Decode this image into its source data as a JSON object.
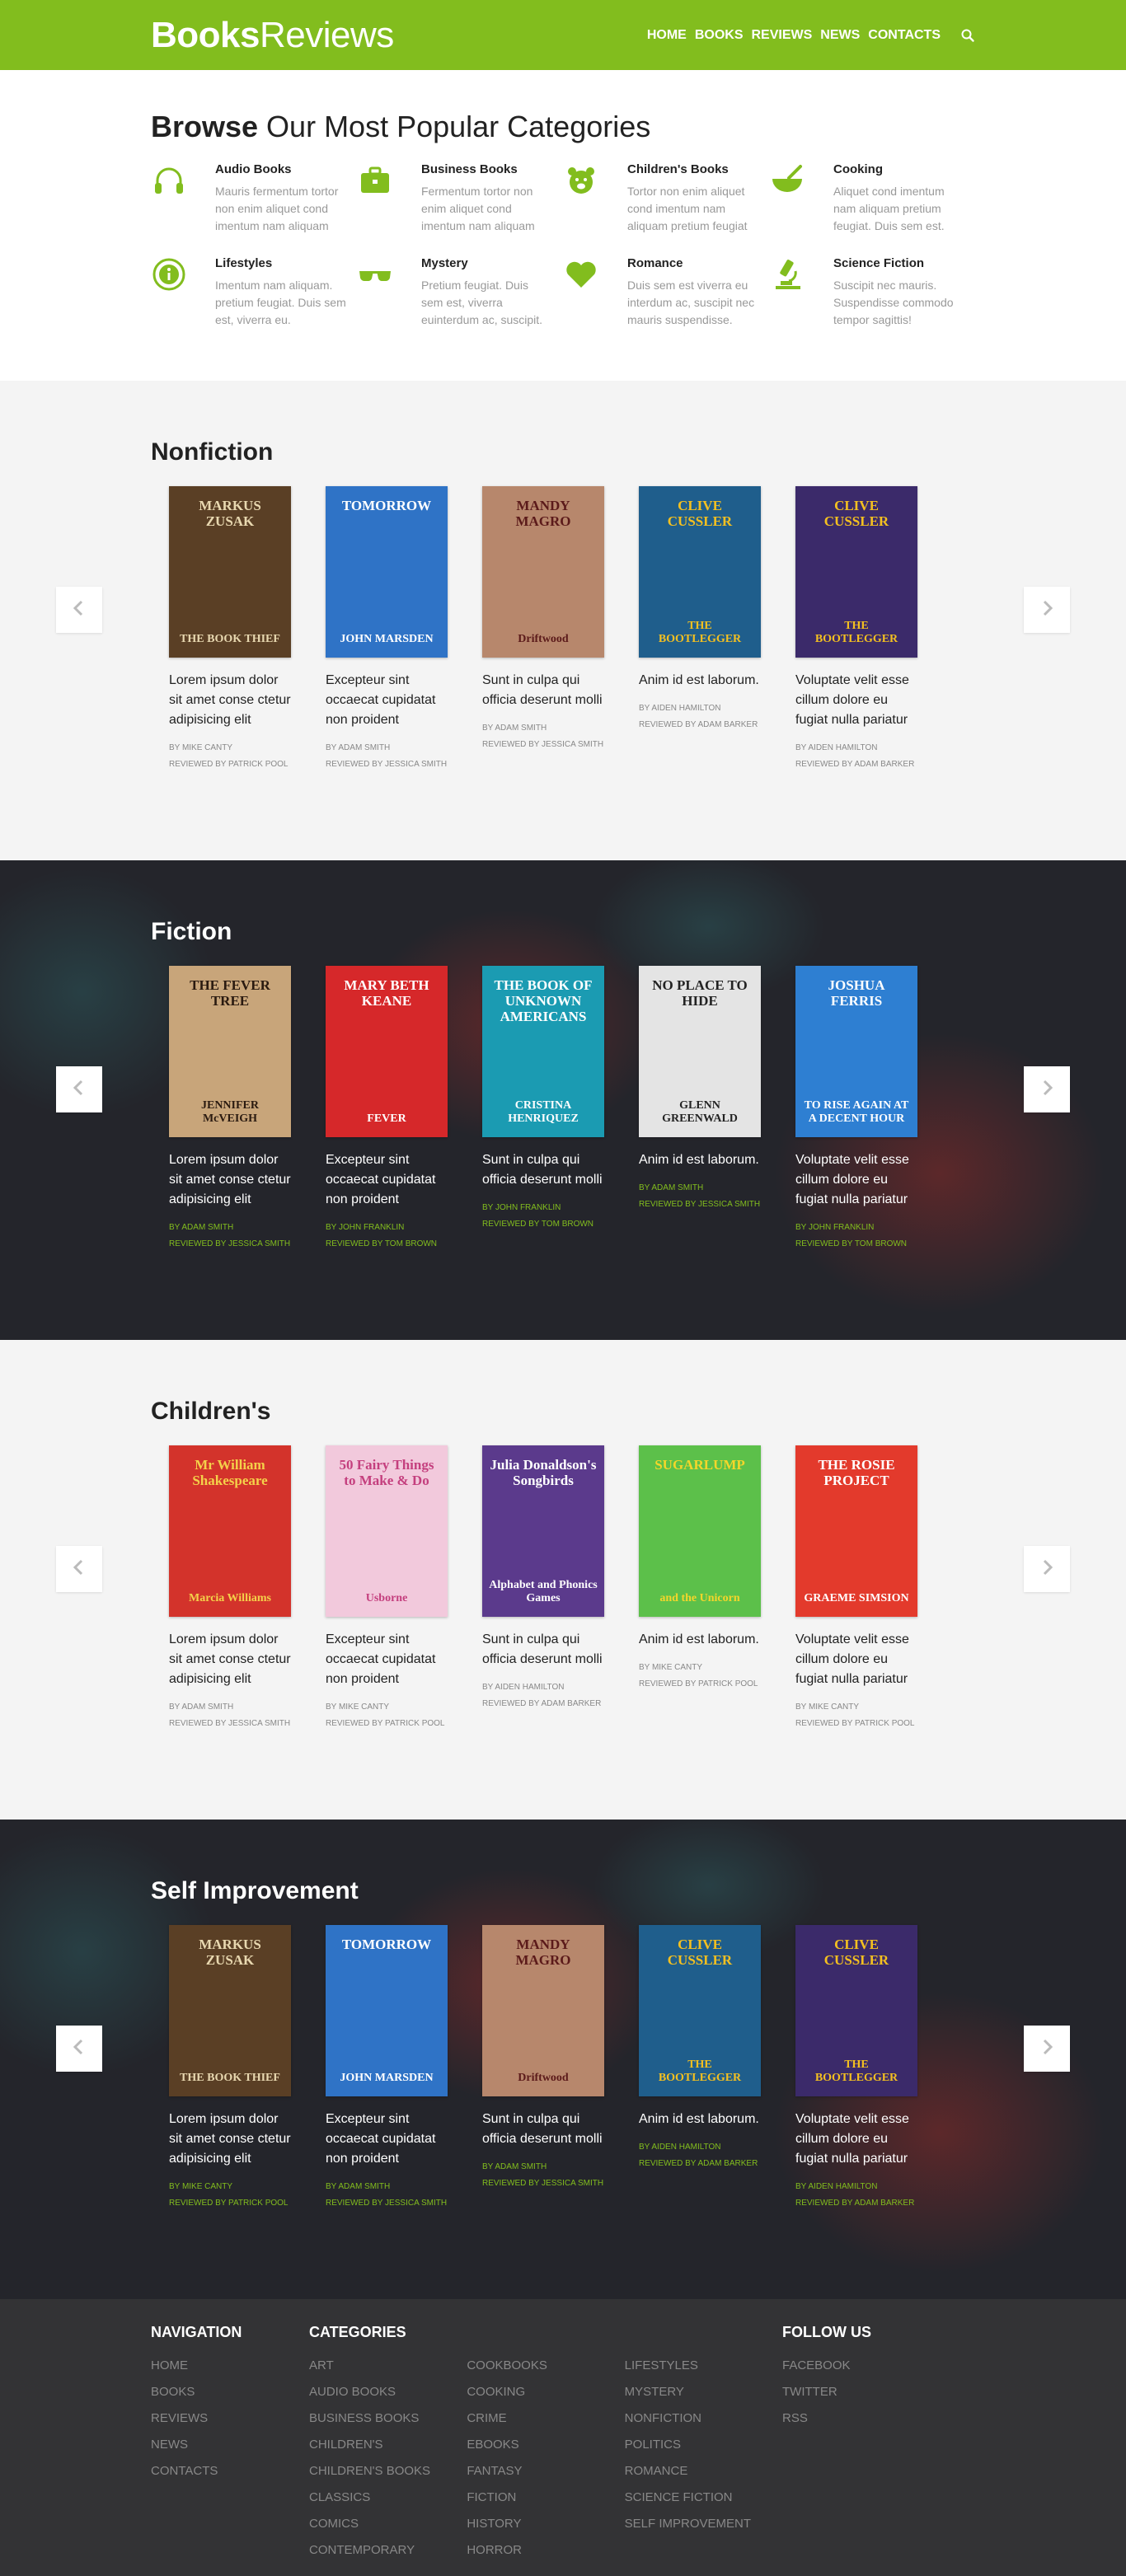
{
  "brand": {
    "bold": "Books",
    "light": "Reviews"
  },
  "nav": [
    "HOME",
    "BOOKS",
    "REVIEWS",
    "NEWS",
    "CONTACTS"
  ],
  "categories_heading": {
    "bold": "Browse",
    "rest": " Our Most Popular Categories"
  },
  "categories": [
    {
      "icon": "headphones-icon",
      "title": "Audio Books",
      "desc": "Mauris fermentum tortor non enim aliquet cond imentum nam aliquam"
    },
    {
      "icon": "briefcase-icon",
      "title": "Business Books",
      "desc": "Fermentum tortor non enim aliquet cond imentum nam aliquam"
    },
    {
      "icon": "teddy-bear-icon",
      "title": "Children's Books",
      "desc": "Tortor non enim aliquet cond imentum nam aliquam pretium feugiat"
    },
    {
      "icon": "mortar-pestle-icon",
      "title": "Cooking",
      "desc": "Aliquet cond imentum nam aliquam pretium feugiat. Duis sem est."
    },
    {
      "icon": "info-circle-icon",
      "title": "Lifestyles",
      "desc": "Imentum nam aliquam. pretium feugiat. Duis sem est, viverra eu."
    },
    {
      "icon": "sunglasses-icon",
      "title": "Mystery",
      "desc": "Pretium feugiat. Duis sem est, viverra euinterdum ac, suscipit."
    },
    {
      "icon": "heart-icon",
      "title": "Romance",
      "desc": "Duis sem est viverra eu interdum ac, suscipit nec mauris suspendisse."
    },
    {
      "icon": "microscope-icon",
      "title": "Science Fiction",
      "desc": "Suscipit nec mauris. Suspendisse commodo tempor sagittis!"
    }
  ],
  "sections": [
    {
      "title": "Nonfiction",
      "theme": "light",
      "books": [
        {
          "title": "Lorem ipsum dolor sit amet conse ctetur adipisicing elit",
          "by": "BY MIKE CANTY",
          "reviewed": "REVIEWED BY PATRICK POOL",
          "cover": {
            "top": "MARKUS ZUSAK",
            "bottom": "THE BOOK THIEF",
            "bg": "#5a3f25",
            "fg": "#e8d8b0"
          }
        },
        {
          "title": "Excepteur sint occaecat cupidatat non proident",
          "by": "BY ADAM SMITH",
          "reviewed": "REVIEWED BY JESSICA SMITH",
          "cover": {
            "top": "TOMORROW",
            "bottom": "JOHN MARSDEN",
            "bg": "#2f73c6",
            "fg": "#ffffff"
          }
        },
        {
          "title": "Sunt in culpa qui officia deserunt molli",
          "by": "BY ADAM SMITH",
          "reviewed": "REVIEWED BY JESSICA SMITH",
          "cover": {
            "top": "MANDY MAGRO",
            "bottom": "Driftwood",
            "bg": "#b7876c",
            "fg": "#5b1a1a"
          }
        },
        {
          "title": "Anim id est laborum.",
          "by": "BY AIDEN HAMILTON",
          "reviewed": "REVIEWED BY ADAM BARKER",
          "cover": {
            "top": "CLIVE CUSSLER",
            "bottom": "THE BOOTLEGGER",
            "bg": "#1f5e8c",
            "fg": "#f4c020"
          }
        },
        {
          "title": "Voluptate velit esse cillum dolore eu fugiat nulla pariatur",
          "by": "BY AIDEN HAMILTON",
          "reviewed": "REVIEWED BY ADAM BARKER",
          "cover": {
            "top": "CLIVE CUSSLER",
            "bottom": "THE BOOTLEGGER",
            "bg": "#3b2a6a",
            "fg": "#f4c020"
          }
        }
      ]
    },
    {
      "title": "Fiction",
      "theme": "dark",
      "books": [
        {
          "title": "Lorem ipsum dolor sit amet conse ctetur adipisicing elit",
          "by": "BY ADAM SMITH",
          "reviewed": "REVIEWED BY JESSICA SMITH",
          "cover": {
            "top": "THE FEVER TREE",
            "bottom": "JENNIFER McVEIGH",
            "bg": "#c8a57a",
            "fg": "#2a1a10"
          }
        },
        {
          "title": "Excepteur sint occaecat cupidatat non proident",
          "by": "BY JOHN FRANKLIN",
          "reviewed": "REVIEWED BY TOM BROWN",
          "cover": {
            "top": "MARY BETH KEANE",
            "bottom": "FEVER",
            "bg": "#d6282a",
            "fg": "#ffffff"
          }
        },
        {
          "title": "Sunt in culpa qui officia deserunt molli",
          "by": "BY JOHN FRANKLIN",
          "reviewed": "REVIEWED BY TOM BROWN",
          "cover": {
            "top": "THE BOOK OF UNKNOWN AMERICANS",
            "bottom": "CRISTINA HENRIQUEZ",
            "bg": "#1b9bb2",
            "fg": "#ffffff"
          }
        },
        {
          "title": "Anim id est laborum.",
          "by": "BY ADAM SMITH",
          "reviewed": "REVIEWED BY JESSICA SMITH",
          "cover": {
            "top": "NO PLACE TO HIDE",
            "bottom": "GLENN GREENWALD",
            "bg": "#e4e4e4",
            "fg": "#222222"
          }
        },
        {
          "title": "Voluptate velit esse cillum dolore eu fugiat nulla pariatur",
          "by": "BY JOHN FRANKLIN",
          "reviewed": "REVIEWED BY TOM BROWN",
          "cover": {
            "top": "JOSHUA FERRIS",
            "bottom": "TO RISE AGAIN AT A DECENT HOUR",
            "bg": "#2e7fd2",
            "fg": "#ffffff"
          }
        }
      ]
    },
    {
      "title": "Children's",
      "theme": "light",
      "books": [
        {
          "title": "Lorem ipsum dolor sit amet conse ctetur adipisicing elit",
          "by": "BY ADAM SMITH",
          "reviewed": "REVIEWED BY JESSICA SMITH",
          "cover": {
            "top": "Mr William Shakespeare",
            "bottom": "Marcia Williams",
            "bg": "#d3332b",
            "fg": "#f4d14a"
          }
        },
        {
          "title": "Excepteur sint occaecat cupidatat non proident",
          "by": "BY MIKE CANTY",
          "reviewed": "REVIEWED BY PATRICK POOL",
          "cover": {
            "top": "50 Fairy Things to Make & Do",
            "bottom": "Usborne",
            "bg": "#f2c9dc",
            "fg": "#c43f7e"
          }
        },
        {
          "title": "Sunt in culpa qui officia deserunt molli",
          "by": "BY AIDEN HAMILTON",
          "reviewed": "REVIEWED BY ADAM BARKER",
          "cover": {
            "top": "Julia Donaldson's Songbirds",
            "bottom": "Alphabet and Phonics Games",
            "bg": "#5b3a8c",
            "fg": "#ffffff"
          }
        },
        {
          "title": "Anim id est laborum.",
          "by": "BY MIKE CANTY",
          "reviewed": "REVIEWED BY PATRICK POOL",
          "cover": {
            "top": "SUGARLUMP",
            "bottom": "and the Unicorn",
            "bg": "#5cc04a",
            "fg": "#f4d62a"
          }
        },
        {
          "title": "Voluptate velit esse cillum dolore eu fugiat nulla pariatur",
          "by": "BY MIKE CANTY",
          "reviewed": "REVIEWED BY PATRICK POOL",
          "cover": {
            "top": "THE ROSIE PROJECT",
            "bottom": "GRAEME SIMSION",
            "bg": "#e33a2c",
            "fg": "#ffffff"
          }
        }
      ]
    },
    {
      "title": "Self Improvement",
      "theme": "dark",
      "books": [
        {
          "title": "Lorem ipsum dolor sit amet conse ctetur adipisicing elit",
          "by": "BY MIKE CANTY",
          "reviewed": "REVIEWED BY PATRICK POOL",
          "cover": {
            "top": "MARKUS ZUSAK",
            "bottom": "THE BOOK THIEF",
            "bg": "#5a3f25",
            "fg": "#e8d8b0"
          }
        },
        {
          "title": "Excepteur sint occaecat cupidatat non proident",
          "by": "BY ADAM SMITH",
          "reviewed": "REVIEWED BY JESSICA SMITH",
          "cover": {
            "top": "TOMORROW",
            "bottom": "JOHN MARSDEN",
            "bg": "#2f73c6",
            "fg": "#ffffff"
          }
        },
        {
          "title": "Sunt in culpa qui officia deserunt molli",
          "by": "BY ADAM SMITH",
          "reviewed": "REVIEWED BY JESSICA SMITH",
          "cover": {
            "top": "MANDY MAGRO",
            "bottom": "Driftwood",
            "bg": "#b7876c",
            "fg": "#5b1a1a"
          }
        },
        {
          "title": "Anim id est laborum.",
          "by": "BY AIDEN HAMILTON",
          "reviewed": "REVIEWED BY ADAM BARKER",
          "cover": {
            "top": "CLIVE CUSSLER",
            "bottom": "THE BOOTLEGGER",
            "bg": "#1f5e8c",
            "fg": "#f4c020"
          }
        },
        {
          "title": "Voluptate velit esse cillum dolore eu fugiat nulla pariatur",
          "by": "BY AIDEN HAMILTON",
          "reviewed": "REVIEWED BY ADAM BARKER",
          "cover": {
            "top": "CLIVE CUSSLER",
            "bottom": "THE BOOTLEGGER",
            "bg": "#3b2a6a",
            "fg": "#f4c020"
          }
        }
      ]
    }
  ],
  "footer": {
    "nav_heading": "NAVIGATION",
    "nav": [
      "HOME",
      "BOOKS",
      "REVIEWS",
      "NEWS",
      "CONTACTS"
    ],
    "cat_heading": "CATEGORIES",
    "cats": [
      [
        "ART",
        "AUDIO BOOKS",
        "BUSINESS BOOKS",
        "CHILDREN'S",
        "CHILDREN'S BOOKS",
        "CLASSICS",
        "COMICS",
        "CONTEMPORARY"
      ],
      [
        "COOKBOOKS",
        "COOKING",
        "CRIME",
        "EBOOKS",
        "FANTASY",
        "FICTION",
        "HISTORY",
        "HORROR"
      ],
      [
        "LIFESTYLES",
        "MYSTERY",
        "NONFICTION",
        "POLITICS",
        "ROMANCE",
        "SCIENCE FICTION",
        "SELF IMPROVEMENT"
      ]
    ],
    "follow_heading": "FOLLOW US",
    "follow": [
      "FACEBOOK",
      "TWITTER",
      "RSS"
    ]
  },
  "colors": {
    "accent": "#82bd1e",
    "dark_bg": "#24252b",
    "footer_bg": "#333335"
  }
}
